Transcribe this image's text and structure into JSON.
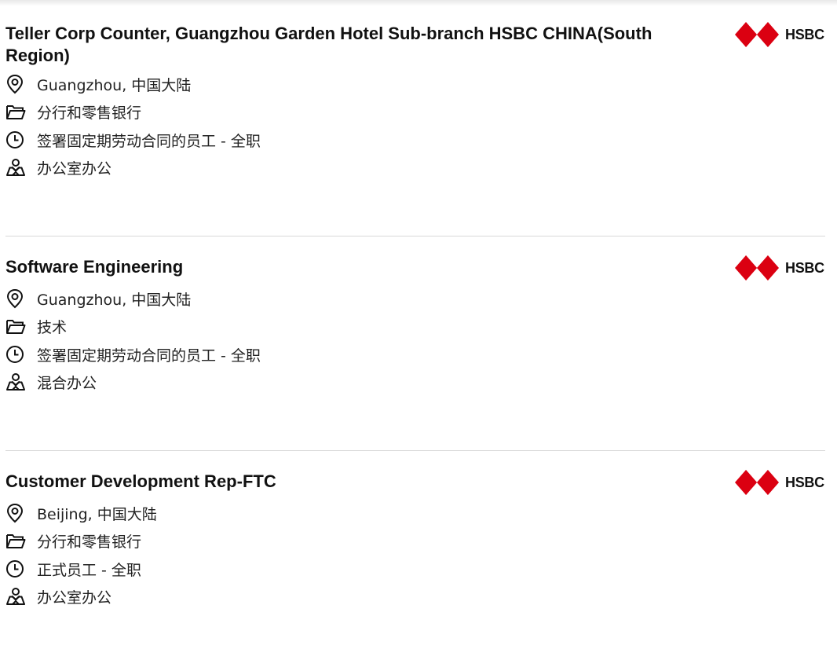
{
  "jobs": [
    {
      "title": "Teller Corp Counter, Guangzhou Garden Hotel Sub-branch HSBC CHINA(South Region)",
      "logo_text": "HSBC",
      "location": "Guangzhou, 中国大陆",
      "category": "分行和零售银行",
      "employment": "签署固定期劳动合同的员工 - 全职",
      "work_mode": "办公室办公"
    },
    {
      "title": "Software Engineering",
      "logo_text": "HSBC",
      "location": "Guangzhou, 中国大陆",
      "category": "技术",
      "employment": "签署固定期劳动合同的员工 - 全职",
      "work_mode": "混合办公"
    },
    {
      "title": "Customer Development Rep-FTC",
      "logo_text": "HSBC",
      "location": "Beijing, 中国大陆",
      "category": "分行和零售银行",
      "employment": "正式员工 - 全职",
      "work_mode": "办公室办公"
    }
  ],
  "colors": {
    "brand_red": "#db0011",
    "divider": "#d9d9d9",
    "title_text": "#111111"
  },
  "icons": [
    "location-pin-icon",
    "folder-icon",
    "clock-icon",
    "office-person-icon",
    "hsbc-hexagon-logo"
  ]
}
